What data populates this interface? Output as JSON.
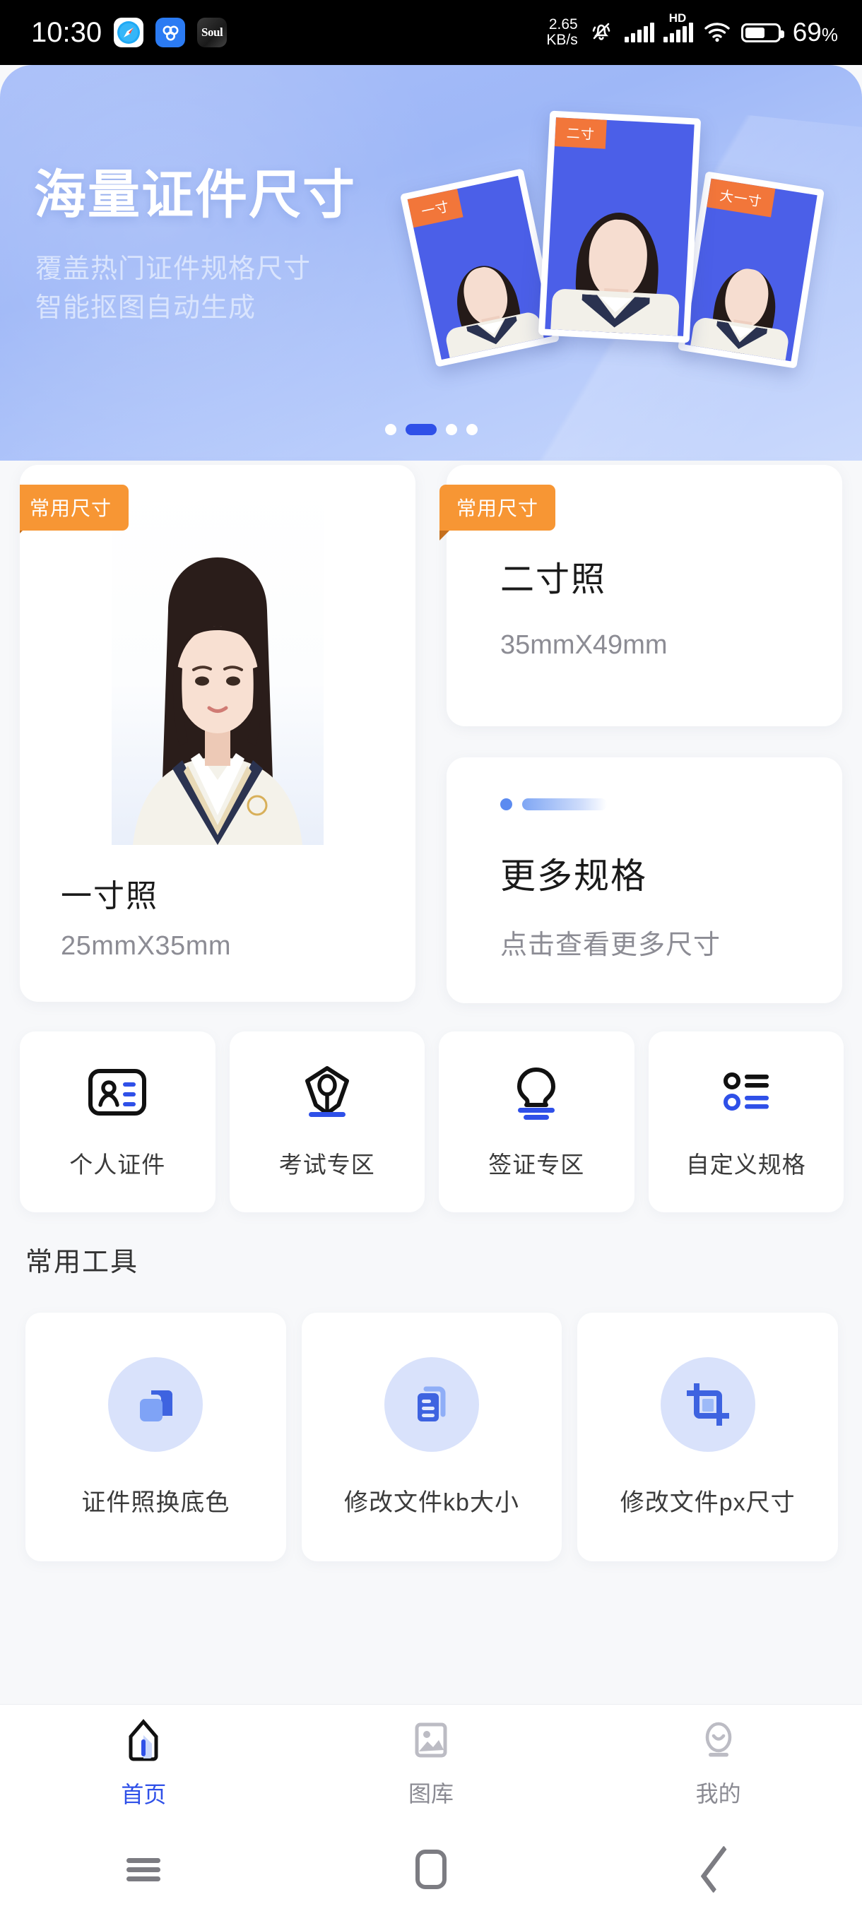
{
  "status_bar": {
    "time": "10:30",
    "app_icons": [
      {
        "name": "safari-icon",
        "label": ""
      },
      {
        "name": "baidu-netdisk-icon",
        "label": ""
      },
      {
        "name": "soul-app-icon",
        "label": "Soul"
      }
    ],
    "network_speed_value": "2.65",
    "network_speed_unit": "KB/s",
    "icons": [
      "mute-bell-icon",
      "signal-bars-icon",
      "hd-signal-icon",
      "wifi-icon",
      "battery-icon"
    ],
    "hd_label": "HD",
    "battery_percent": "69",
    "battery_percent_symbol": "%"
  },
  "hero": {
    "title": "海量证件尺寸",
    "subtitle_line1": "覆盖热门证件规格尺寸",
    "subtitle_line2": "智能抠图自动生成",
    "photo_cards": [
      {
        "badge": "一寸"
      },
      {
        "badge": "二寸"
      },
      {
        "badge": "大一寸"
      }
    ],
    "carousel": {
      "total": 4,
      "active_index": 1
    }
  },
  "size_cards": {
    "badge_label": "常用尺寸",
    "one_inch": {
      "title": "一寸照",
      "dimensions": "25mmX35mm"
    },
    "two_inch": {
      "title": "二寸照",
      "dimensions": "35mmX49mm"
    },
    "more": {
      "title": "更多规格",
      "subtitle": "点击查看更多尺寸"
    }
  },
  "categories": [
    {
      "label": "个人证件",
      "icon": "id-card-icon"
    },
    {
      "label": "考试专区",
      "icon": "pen-nib-icon"
    },
    {
      "label": "签证专区",
      "icon": "stamp-icon"
    },
    {
      "label": "自定义规格",
      "icon": "list-options-icon"
    }
  ],
  "tools_section": {
    "heading": "常用工具",
    "items": [
      {
        "label": "证件照换底色",
        "icon": "color-swap-icon"
      },
      {
        "label": "修改文件kb大小",
        "icon": "file-size-icon"
      },
      {
        "label": "修改文件px尺寸",
        "icon": "crop-icon"
      }
    ]
  },
  "tab_bar": [
    {
      "label": "首页",
      "icon": "home-icon",
      "active": true
    },
    {
      "label": "图库",
      "icon": "gallery-icon",
      "active": false
    },
    {
      "label": "我的",
      "icon": "profile-icon",
      "active": false
    }
  ],
  "system_nav": [
    {
      "name": "recents-button",
      "icon": "hamburger-icon"
    },
    {
      "name": "home-button",
      "icon": "rounded-square-icon"
    },
    {
      "name": "back-button",
      "icon": "chevron-left-icon"
    }
  ],
  "colors": {
    "accent_blue": "#2F50E8",
    "badge_orange": "#F79634",
    "hero_blue": "#9EB7F7",
    "page_background": "#F7F8FA",
    "muted_text": "#8C8C94"
  }
}
